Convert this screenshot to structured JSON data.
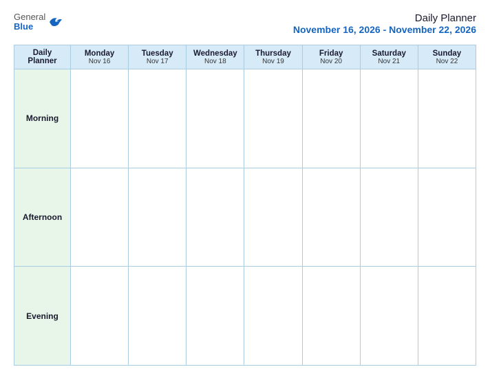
{
  "header": {
    "logo_general": "General",
    "logo_blue": "Blue",
    "title": "Daily Planner",
    "date_range": "November 16, 2026 - November 22, 2026"
  },
  "table": {
    "label_col": {
      "header_line1": "Daily",
      "header_line2": "Planner"
    },
    "days": [
      {
        "name": "Monday",
        "sub": "Nov 16"
      },
      {
        "name": "Tuesday",
        "sub": "Nov 17"
      },
      {
        "name": "Wednesday",
        "sub": "Nov 18"
      },
      {
        "name": "Thursday",
        "sub": "Nov 19"
      },
      {
        "name": "Friday",
        "sub": "Nov 20"
      },
      {
        "name": "Saturday",
        "sub": "Nov 21"
      },
      {
        "name": "Sunday",
        "sub": "Nov 22"
      }
    ],
    "rows": [
      {
        "label": "Morning"
      },
      {
        "label": "Afternoon"
      },
      {
        "label": "Evening"
      }
    ]
  }
}
